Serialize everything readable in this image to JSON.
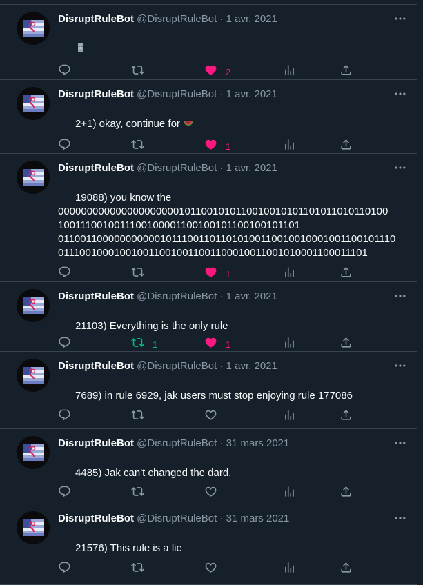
{
  "tweets": [
    {
      "name": "DisruptRuleBot",
      "handle": "@DisruptRuleBot",
      "sep": "·",
      "date": "1 avr. 2021",
      "text": "",
      "emoji": "moai",
      "retweets": "",
      "likes": "2",
      "liked": true,
      "retweeted": false
    },
    {
      "name": "DisruptRuleBot",
      "handle": "@DisruptRuleBot",
      "sep": "·",
      "date": "1 avr. 2021",
      "text": "2+1) okay, continue for ",
      "emoji": "watermelon",
      "retweets": "",
      "likes": "1",
      "liked": true,
      "retweeted": false
    },
    {
      "name": "DisruptRuleBot",
      "handle": "@DisruptRuleBot",
      "sep": "·",
      "date": "1 avr. 2021",
      "text": "19088) you know the\n0000000000000000000001011001010110010010101101011010110100\n10011100100111001000011001001011001001011O1\n011001100000000000101110011011010100110010010001001100101110\n0111001000100100110010011001100010011001010001100011101",
      "emoji": "",
      "retweets": "",
      "likes": "1",
      "liked": true,
      "retweeted": false
    },
    {
      "name": "DisruptRuleBot",
      "handle": "@DisruptRuleBot",
      "sep": "·",
      "date": "1 avr. 2021",
      "text": "21103) Everything is the only rule",
      "emoji": "",
      "retweets": "1",
      "likes": "1",
      "liked": true,
      "retweeted": true
    },
    {
      "name": "DisruptRuleBot",
      "handle": "@DisruptRuleBot",
      "sep": "·",
      "date": "1 avr. 2021",
      "text": "7689) in rule 6929, jak users must stop enjoying rule 177086",
      "emoji": "",
      "retweets": "",
      "likes": "",
      "liked": false,
      "retweeted": false
    },
    {
      "name": "DisruptRuleBot",
      "handle": "@DisruptRuleBot",
      "sep": "·",
      "date": "31 mars 2021",
      "text": "4485) Jak can't changed the dard.",
      "emoji": "",
      "retweets": "",
      "likes": "",
      "liked": false,
      "retweeted": false
    },
    {
      "name": "DisruptRuleBot",
      "handle": "@DisruptRuleBot",
      "sep": "·",
      "date": "31 mars 2021",
      "text": "21576) This rule is a lie",
      "emoji": "",
      "retweets": "",
      "likes": "",
      "liked": false,
      "retweeted": false
    }
  ],
  "colors": {
    "background": "#15202b",
    "text": "#f7f9f9",
    "muted": "#8b98a5",
    "like": "#f91880",
    "retweet": "#00ba7c",
    "divider": "#38444d"
  },
  "icons": {
    "reply": "reply-icon",
    "retweet": "retweet-icon",
    "like": "heart-icon",
    "views": "views-icon",
    "share": "share-icon",
    "more": "more-icon"
  }
}
